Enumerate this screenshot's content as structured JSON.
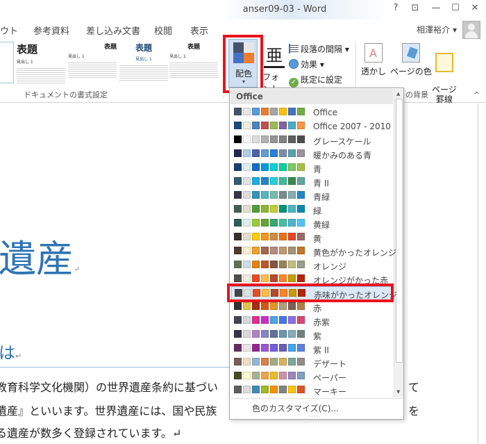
{
  "titlebar": {
    "title": "anser09-03 - Word",
    "help": "?",
    "ribbon_display": "⊡",
    "minimize": "—",
    "maximize": "☐",
    "close": "✕"
  },
  "tabs": [
    "ウト",
    "参考資料",
    "差し込み文書",
    "校閲",
    "表示"
  ],
  "user": {
    "name": "相澤裕介",
    "caret": "▾"
  },
  "ribbon": {
    "style_thumbs": [
      {
        "title": "表題",
        "sub": "見出し 1"
      },
      {
        "title": "表題",
        "sub": "見出し 1"
      },
      {
        "title": "表題",
        "sub": "見出し 1"
      },
      {
        "title": "表題",
        "sub": "見出し 1"
      }
    ],
    "group_label": "ドキュメントの書式設定",
    "haishoku_label": "配色",
    "caret": "▾",
    "font_glyph": "亜",
    "font_label": "フォント",
    "paragraph_spacing": "段落の間隔 ▾",
    "effects": "効果 ▾",
    "set_default": "既定に設定",
    "watermark": "透かし",
    "page_color": "ページの色",
    "page_border": "ページ\n罫線",
    "page_bg_label": "の背景",
    "collapse": "^"
  },
  "document": {
    "heading": "遺産",
    "subheading": "は",
    "return_mark": "↵",
    "lines": [
      "教育科学文化機関）の世界遺産条約に基づい",
      "遺産』といいます。世界遺産には、国や民族",
      "る遺産が数多く登録されています。↵"
    ],
    "right_fragments": [
      "て",
      "を"
    ]
  },
  "dropdown": {
    "header": "Office",
    "customize": "色のカスタマイズ(C)...",
    "grip": "·····",
    "scroll_up": "▲",
    "scroll_down": "▼",
    "selected_index": 13,
    "schemes": [
      {
        "name": "Office",
        "colors": [
          "#44546a",
          "#e7e6e6",
          "#5b9bd5",
          "#ed7d31",
          "#a5a5a5",
          "#ffc000",
          "#4472c4",
          "#70ad47"
        ]
      },
      {
        "name": "Office 2007 - 2010",
        "colors": [
          "#1f497d",
          "#eeece1",
          "#4f81bd",
          "#c0504d",
          "#9bbb59",
          "#8064a2",
          "#4bacc6",
          "#f79646"
        ]
      },
      {
        "name": "グレースケール",
        "colors": [
          "#000000",
          "#f8f8f8",
          "#dddddd",
          "#b2b2b2",
          "#969696",
          "#808080",
          "#5f5f5f",
          "#4d4d4d"
        ]
      },
      {
        "name": "暖かみのある青",
        "colors": [
          "#242852",
          "#acccea",
          "#4a66ac",
          "#629dd1",
          "#297fd5",
          "#7f8fa9",
          "#5aa2ae",
          "#9d90a0"
        ]
      },
      {
        "name": "青",
        "colors": [
          "#17406d",
          "#dbeff9",
          "#0f6fc6",
          "#009dd9",
          "#0bd0d9",
          "#10cf9b",
          "#7cca62",
          "#a5c249"
        ]
      },
      {
        "name": "青 II",
        "colors": [
          "#335b74",
          "#dfe3e5",
          "#1cade4",
          "#2683c6",
          "#27ced7",
          "#42ba97",
          "#3e8853",
          "#62a39f"
        ]
      },
      {
        "name": "青緑",
        "colors": [
          "#373545",
          "#dedede",
          "#3494ba",
          "#58b6c0",
          "#75bda7",
          "#7a8c8e",
          "#84acb6",
          "#2683c6"
        ]
      },
      {
        "name": "緑",
        "colors": [
          "#455f51",
          "#e3ded1",
          "#549e39",
          "#8ab833",
          "#c0cf3a",
          "#029676",
          "#4ab5c4",
          "#0989b1"
        ]
      },
      {
        "name": "黄緑",
        "colors": [
          "#2f5e57",
          "#daf0e8",
          "#99cb38",
          "#63a537",
          "#37a76f",
          "#44c1a3",
          "#4eb3cf",
          "#51c3f9"
        ]
      },
      {
        "name": "黄",
        "colors": [
          "#39302a",
          "#e5dec9",
          "#ffca08",
          "#f8931d",
          "#ce8d3e",
          "#ec7016",
          "#e64823",
          "#9c6a6a"
        ]
      },
      {
        "name": "黄色がかったオレンジ",
        "colors": [
          "#4e3b30",
          "#fbeec9",
          "#f0a22e",
          "#a5644e",
          "#b58b80",
          "#c3986d",
          "#a19574",
          "#c17529"
        ]
      },
      {
        "name": "オレンジ",
        "colors": [
          "#637052",
          "#ccddea",
          "#e48312",
          "#bd582c",
          "#865640",
          "#9b8357",
          "#c2bc80",
          "#94a088"
        ]
      },
      {
        "name": "オレンジがかった赤",
        "colors": [
          "#505046",
          "#eeece1",
          "#e84c22",
          "#ffbd47",
          "#b64926",
          "#ff8427",
          "#cc9900",
          "#b22600"
        ]
      },
      {
        "name": "赤味がかったオレンジ",
        "colors": [
          "#454545",
          "#e0e0e0",
          "#e84c22",
          "#ffbd47",
          "#b64926",
          "#ff8427",
          "#cc9900",
          "#b22600"
        ]
      },
      {
        "name": "赤",
        "colors": [
          "#323232",
          "#e5c243",
          "#a5300f",
          "#d55816",
          "#e19825",
          "#b19c7d",
          "#7f5f52",
          "#b27d49"
        ]
      },
      {
        "name": "赤紫",
        "colors": [
          "#454551",
          "#d8d9dc",
          "#e32d91",
          "#c830cc",
          "#4ea6dc",
          "#4775e7",
          "#8971e1",
          "#d54773"
        ]
      },
      {
        "name": "紫",
        "colors": [
          "#373545",
          "#dcd8dc",
          "#ad84c6",
          "#8784c7",
          "#5d739a",
          "#6997af",
          "#84acb6",
          "#6f8183"
        ]
      },
      {
        "name": "紫 II",
        "colors": [
          "#632e62",
          "#eae5eb",
          "#92278f",
          "#9b57d3",
          "#755dd9",
          "#665eb8",
          "#45a5ed",
          "#5982db"
        ]
      },
      {
        "name": "デザート",
        "colors": [
          "#775f55",
          "#ebddc3",
          "#94b6d2",
          "#dd8047",
          "#a5ab81",
          "#d8b25c",
          "#7ba79d",
          "#968c8c"
        ]
      },
      {
        "name": "ペーパー",
        "colors": [
          "#444d26",
          "#fefac9",
          "#a5b592",
          "#f3a447",
          "#e7bc29",
          "#d092a7",
          "#9c85c0",
          "#809ec2"
        ]
      },
      {
        "name": "マーキー",
        "colors": [
          "#5e5e5e",
          "#dddddd",
          "#418ab3",
          "#a6b727",
          "#f69200",
          "#838383",
          "#fec306",
          "#df5327"
        ]
      }
    ]
  }
}
